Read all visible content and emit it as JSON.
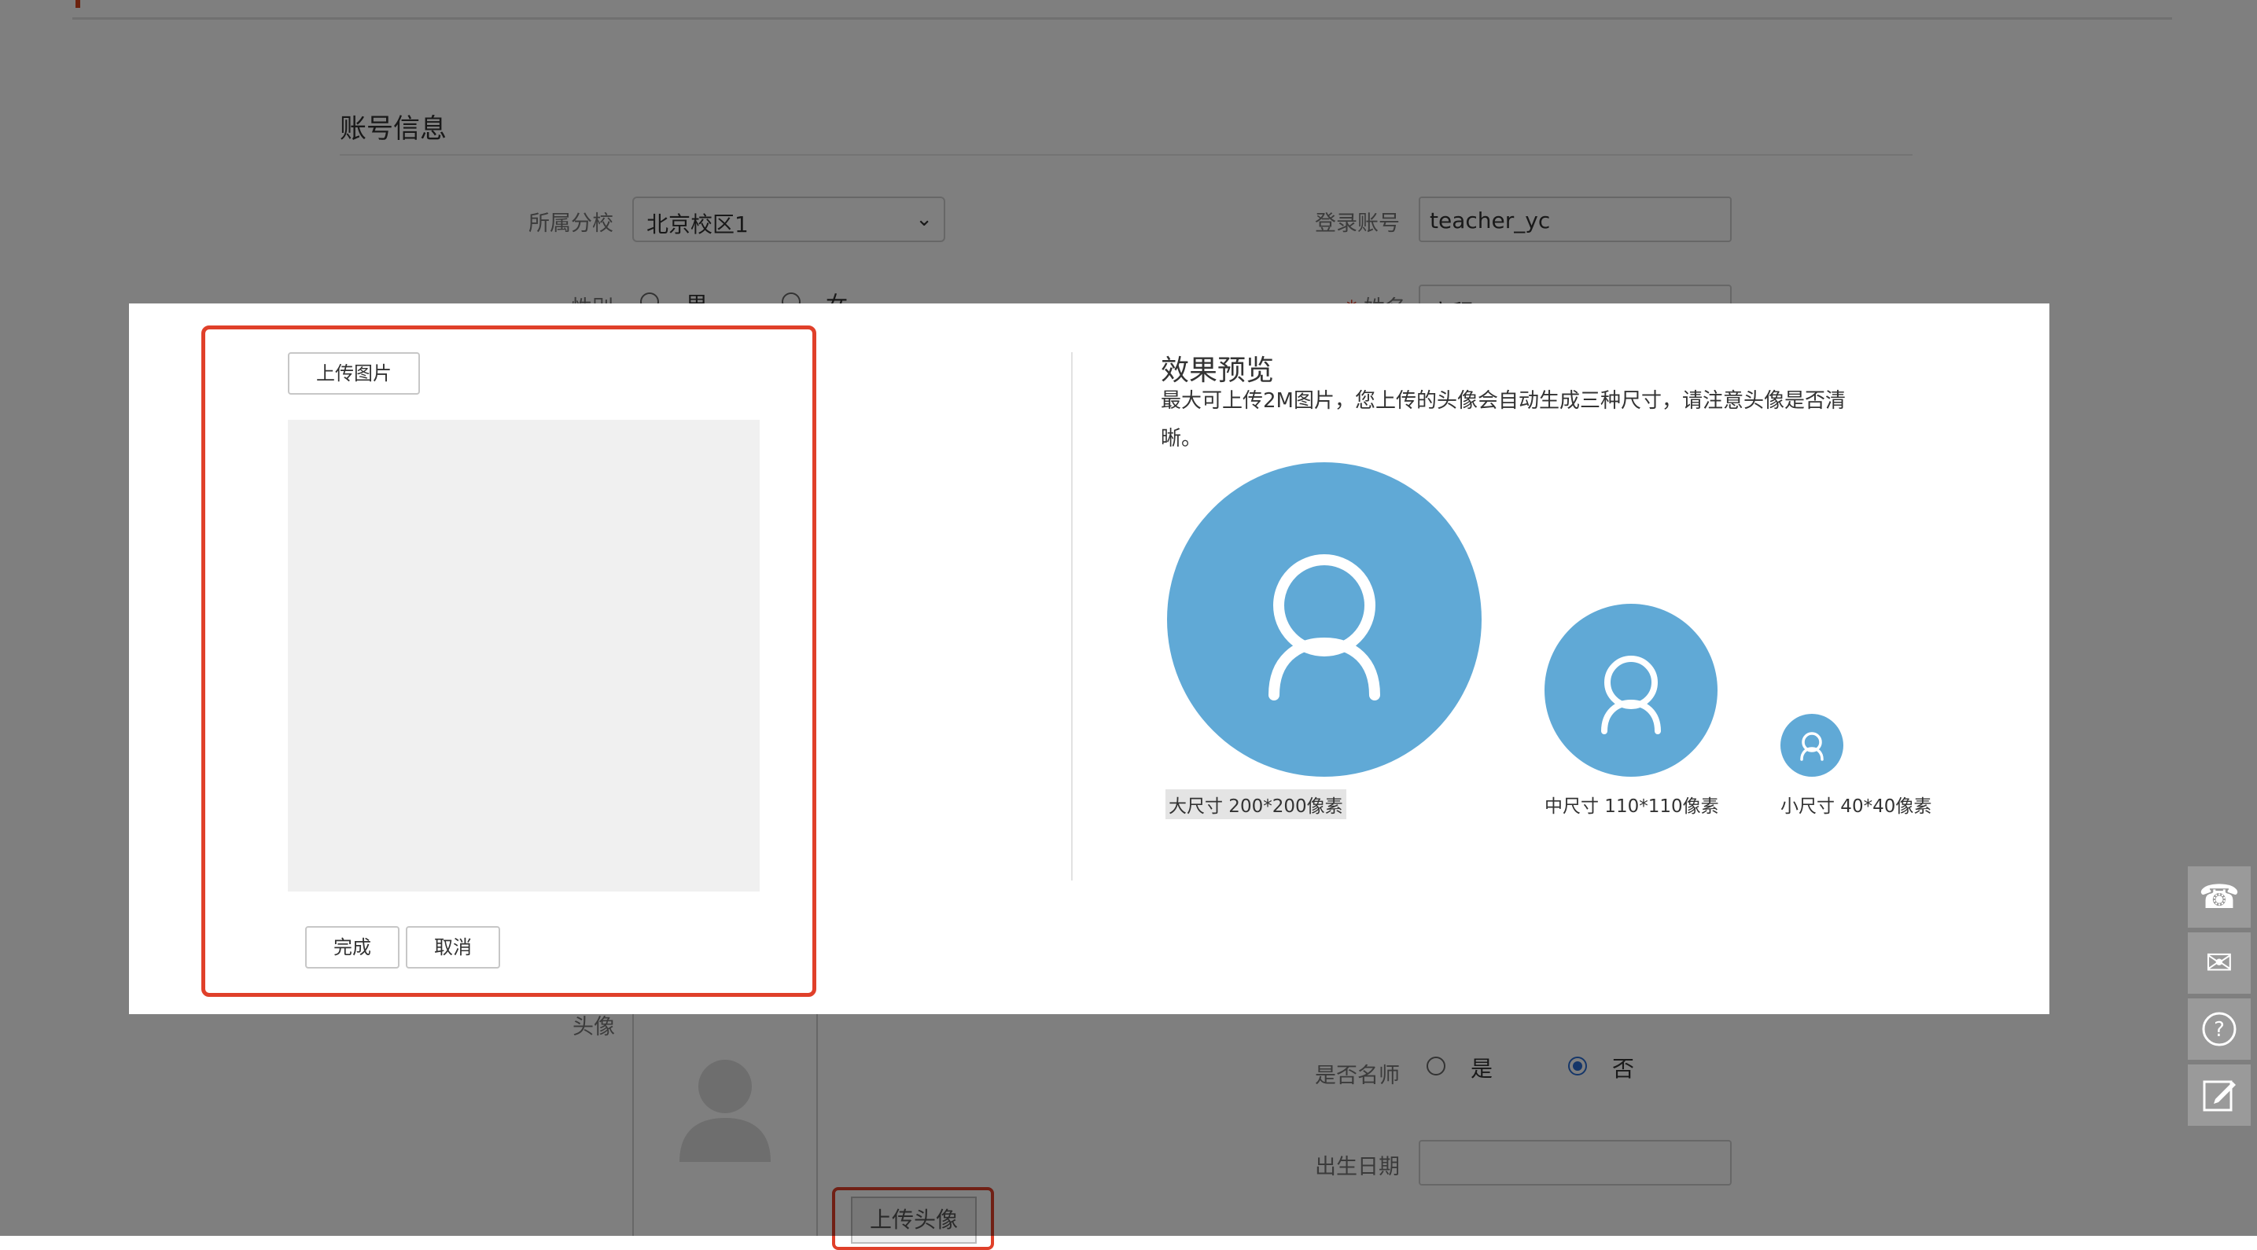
{
  "account_section": {
    "title": "账号信息",
    "campus_label": "所属分校",
    "campus_value": "北京校区1",
    "login_label": "登录账号",
    "login_value": "teacher_yc",
    "gender_label": "性别",
    "gender_male": "男",
    "gender_female": "女",
    "name_label": "姓名",
    "name_value": "高程",
    "avatar_label": "头像",
    "famous_label": "是否名师",
    "famous_yes": "是",
    "famous_no": "否",
    "famous_selected": "否",
    "birth_label": "出生日期",
    "birth_value": "",
    "upload_avatar_button": "上传头像"
  },
  "modal": {
    "upload_image_button": "上传图片",
    "done_button": "完成",
    "cancel_button": "取消",
    "preview_title": "效果预览",
    "preview_desc": "最大可上传2M图片，您上传的头像会自动生成三种尺寸，请注意头像是否清晰。",
    "sizes": {
      "large": "大尺寸 200*200像素",
      "medium": "中尺寸 110*110像素",
      "small": "小尺寸 40*40像素"
    },
    "accent_color": "#60a9d6",
    "highlight_color": "#e0402a"
  },
  "side_toolbar": [
    "phone-icon",
    "mail-icon",
    "help-icon",
    "edit-icon"
  ]
}
